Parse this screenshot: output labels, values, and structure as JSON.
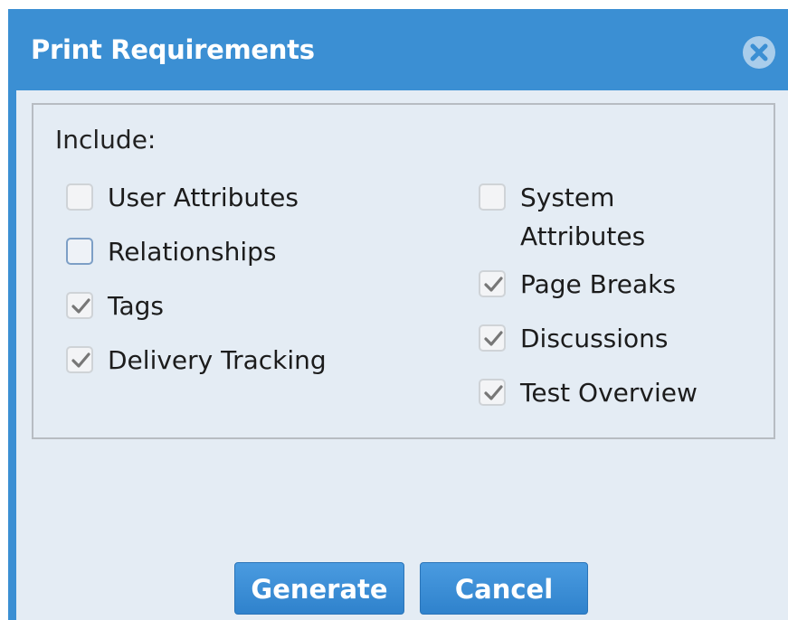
{
  "dialog": {
    "title": "Print Requirements",
    "include_label": "Include:"
  },
  "options_left": [
    {
      "label": "User Attributes",
      "checked": false
    },
    {
      "label": "Relationships",
      "checked": false
    },
    {
      "label": "Tags",
      "checked": true
    },
    {
      "label": "Delivery Tracking",
      "checked": true
    }
  ],
  "options_right": [
    {
      "label": "System Attributes",
      "checked": false
    },
    {
      "label": "Page Breaks",
      "checked": true
    },
    {
      "label": "Discussions",
      "checked": true
    },
    {
      "label": "Test Overview",
      "checked": true
    }
  ],
  "buttons": {
    "generate": "Generate",
    "cancel": "Cancel"
  },
  "icons": {
    "close": "close-circle-icon",
    "check": "checkmark-icon"
  },
  "colors": {
    "titlebar": "#3b8fd3",
    "body": "#e4ecf4",
    "button": "#3a8fd6"
  }
}
